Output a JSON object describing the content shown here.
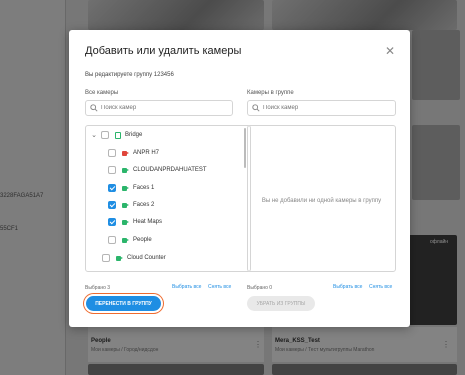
{
  "background": {
    "left_camera_ids": [
      "3228FAGA51A7",
      "55CF1"
    ],
    "tiles": [
      {
        "title": "People",
        "subtitle": "Мои камеры / Город/нидсдон",
        "badge": ""
      },
      {
        "title": "Mera_KSS_Test",
        "subtitle": "Мои камеры / Тест мультигруппы Marathon",
        "badge": "офлайн"
      }
    ],
    "top_right_badge": "офлайн"
  },
  "modal": {
    "title": "Добавить или удалить камеры",
    "subtitle": "Вы редактируете группу 123456",
    "left": {
      "label": "Все камеры",
      "search_placeholder": "Поиск камер",
      "tree": [
        {
          "label": "Bridge",
          "type": "folder",
          "checked": false
        },
        {
          "label": "ANPR H7",
          "type": "camera",
          "icon_color": "#e0453b",
          "checked": false
        },
        {
          "label": "CLOUDANPRDAHUATEST",
          "type": "camera",
          "icon_color": "#2bb56b",
          "checked": false
        },
        {
          "label": "Faces 1",
          "type": "camera",
          "icon_color": "#2bb56b",
          "checked": true
        },
        {
          "label": "Faces 2",
          "type": "camera",
          "icon_color": "#2bb56b",
          "checked": true
        },
        {
          "label": "Heat Maps",
          "type": "camera",
          "icon_color": "#2bb56b",
          "checked": true
        },
        {
          "label": "People",
          "type": "camera",
          "icon_color": "#2bb56b",
          "checked": false
        },
        {
          "label": "Cloud Counter",
          "type": "camera",
          "icon_color": "#2bb56b",
          "checked": false
        }
      ],
      "selected_count": "Выбрано 3",
      "select_all": "Выбрать все",
      "clear_all": "Снять все",
      "action_button": "ПЕРЕНЕСТИ В ГРУППУ"
    },
    "right": {
      "label": "Камеры в группе",
      "search_placeholder": "Поиск камер",
      "empty_message": "Вы не добавили ни одной камеры в группу",
      "selected_count": "Выбрано 0",
      "select_all": "Выбрать все",
      "clear_all": "Снять все",
      "action_button": "УБРАТЬ ИЗ ГРУППЫ"
    },
    "colors": {
      "accent": "#1f8ee3",
      "focus_ring": "#ef6b2f"
    }
  }
}
